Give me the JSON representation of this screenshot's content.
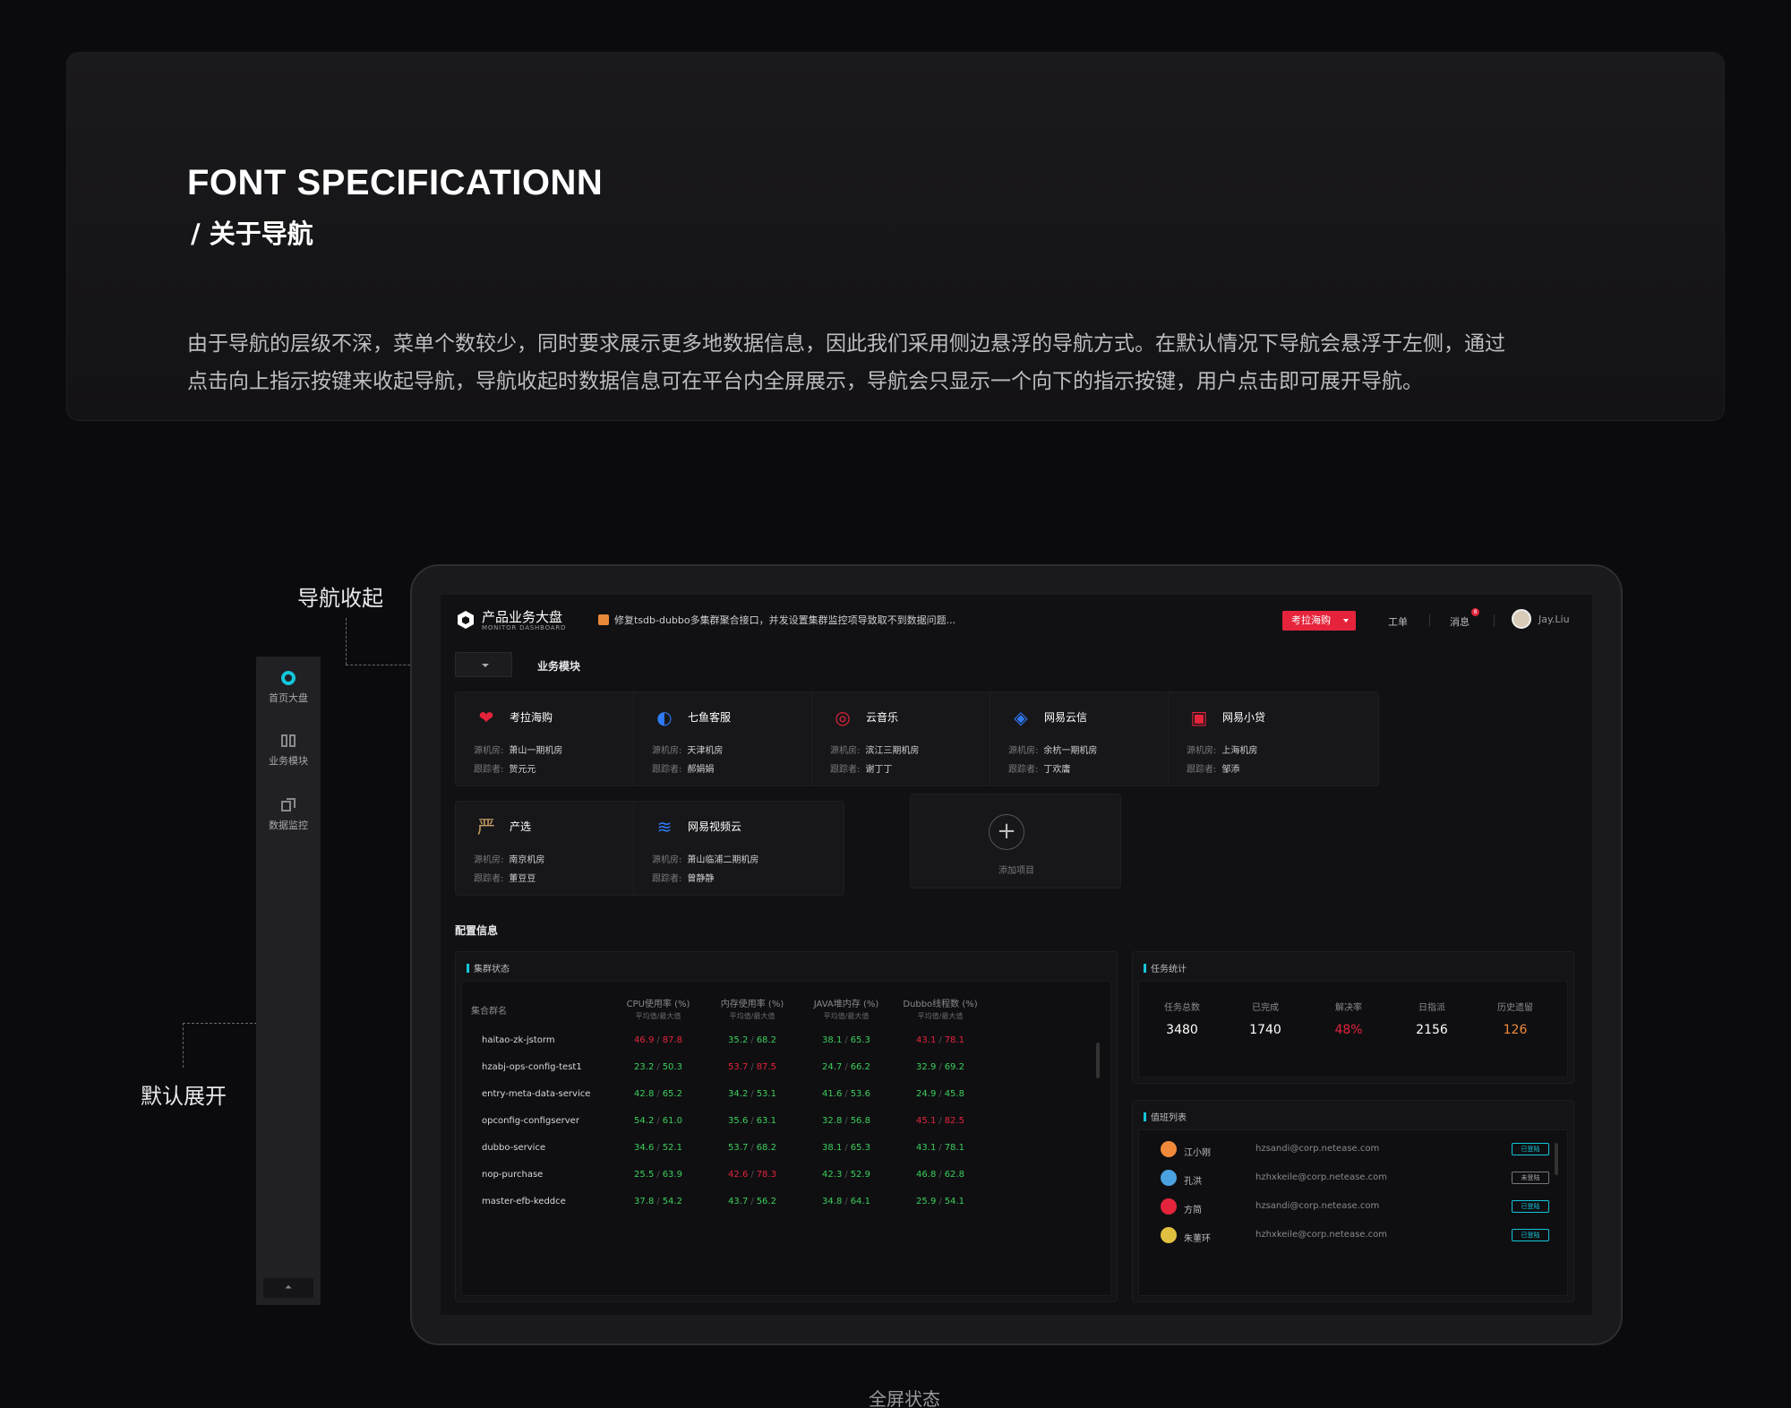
{
  "header": {
    "title": "FONT SPECIFICATIONN",
    "subtitle": "/ 关于导航",
    "desc_line1": "由于导航的层级不深，菜单个数较少，同时要求展示更多地数据信息，因此我们采用侧边悬浮的导航方式。在默认情况下导航会悬浮于左侧，通过",
    "desc_line2": "点击向上指示按键来收起导航，导航收起时数据信息可在平台内全屏展示，导航会只显示一个向下的指示按键，用户点击即可展开导航。"
  },
  "annotations": {
    "collapsed": "导航收起",
    "expanded": "默认展开",
    "caption": "全屏状态"
  },
  "left_nav": {
    "items": [
      {
        "label": "首页大盘",
        "icon": "dashboard-icon"
      },
      {
        "label": "业务模块",
        "icon": "module-icon"
      },
      {
        "label": "数据监控",
        "icon": "monitor-icon"
      }
    ]
  },
  "topbar": {
    "logo_title": "产品业务大盘",
    "logo_sub": "MONITOR DASHBOARD",
    "notice": "修复tsdb-dubbo多集群聚合接口，并发设置集群监控项导致取不到数据问题...",
    "project_button": "考拉海购",
    "links": {
      "work": "工单",
      "msg": "消息"
    },
    "msg_count": "8",
    "user": "Jay.Liu"
  },
  "modules": {
    "section_title": "业务模块",
    "label_room": "源机房:",
    "label_owner": "跟踪者:",
    "cards": [
      {
        "name": "考拉海购",
        "room": "萧山一期机房",
        "owner": "贺元元",
        "icon": "kaola-icon",
        "color": "#e5243b",
        "glyph": "❤"
      },
      {
        "name": "七鱼客服",
        "room": "天津机房",
        "owner": "郝娟娟",
        "icon": "qiyu-icon",
        "color": "#2f7bf5",
        "glyph": "◐"
      },
      {
        "name": "云音乐",
        "room": "滨江三期机房",
        "owner": "谢丁丁",
        "icon": "music-icon",
        "color": "#e5243b",
        "glyph": "◎"
      },
      {
        "name": "网易云信",
        "room": "余杭一期机房",
        "owner": "丁欢庸",
        "icon": "yunxin-icon",
        "color": "#2f7bf5",
        "glyph": "◈"
      },
      {
        "name": "网易小贷",
        "room": "上海机房",
        "owner": "邹添",
        "icon": "loan-icon",
        "color": "#e5243b",
        "glyph": "▣"
      },
      {
        "name": "产选",
        "room": "南京机房",
        "owner": "董豆豆",
        "icon": "yanxuan-icon",
        "color": "#c9a063",
        "glyph": "严"
      },
      {
        "name": "网易视频云",
        "room": "萧山临浦二期机房",
        "owner": "曾静静",
        "icon": "video-cloud-icon",
        "color": "#2f7bf5",
        "glyph": "≋"
      }
    ],
    "add_label": "添加项目"
  },
  "config": {
    "section_title": "配置信息",
    "cluster": {
      "title": "集群状态",
      "headers": [
        {
          "label": "集合群名",
          "sub": ""
        },
        {
          "label": "CPU使用率 (%)",
          "sub": "平均值/最大值"
        },
        {
          "label": "内存使用率 (%)",
          "sub": "平均值/最大值"
        },
        {
          "label": "JAVA堆内存 (%)",
          "sub": "平均值/最大值"
        },
        {
          "label": "Dubbo线程数 (%)",
          "sub": "平均值/最大值"
        }
      ],
      "rows": [
        {
          "name": "haitao-zk-jstorm",
          "cells": [
            [
              "46.9",
              "87.8",
              "r"
            ],
            [
              "35.2",
              "68.2",
              "g"
            ],
            [
              "38.1",
              "65.3",
              "g"
            ],
            [
              "43.1",
              "78.1",
              "r"
            ]
          ]
        },
        {
          "name": "hzabj-ops-config-test1",
          "cells": [
            [
              "23.2",
              "50.3",
              "g"
            ],
            [
              "53.7",
              "87.5",
              "r"
            ],
            [
              "24.7",
              "66.2",
              "g"
            ],
            [
              "32.9",
              "69.2",
              "g"
            ]
          ]
        },
        {
          "name": "entry-meta-data-service",
          "cells": [
            [
              "42.8",
              "65.2",
              "g"
            ],
            [
              "34.2",
              "53.1",
              "g"
            ],
            [
              "41.6",
              "53.6",
              "g"
            ],
            [
              "24.9",
              "45.8",
              "g"
            ]
          ]
        },
        {
          "name": "opconfig-configserver",
          "cells": [
            [
              "54.2",
              "61.0",
              "g"
            ],
            [
              "35.6",
              "63.1",
              "g"
            ],
            [
              "32.8",
              "56.8",
              "g"
            ],
            [
              "45.1",
              "82.5",
              "r"
            ]
          ]
        },
        {
          "name": "dubbo-service",
          "cells": [
            [
              "34.6",
              "52.1",
              "g"
            ],
            [
              "53.7",
              "68.2",
              "g"
            ],
            [
              "38.1",
              "65.3",
              "g"
            ],
            [
              "43.1",
              "78.1",
              "g"
            ]
          ]
        },
        {
          "name": "nop-purchase",
          "cells": [
            [
              "25.5",
              "63.9",
              "g"
            ],
            [
              "42.6",
              "78.3",
              "r"
            ],
            [
              "42.3",
              "52.9",
              "g"
            ],
            [
              "46.8",
              "62.8",
              "g"
            ]
          ]
        },
        {
          "name": "master-efb-keddce",
          "cells": [
            [
              "37.8",
              "54.2",
              "g"
            ],
            [
              "43.7",
              "56.2",
              "g"
            ],
            [
              "34.8",
              "64.1",
              "g"
            ],
            [
              "25.9",
              "54.1",
              "g"
            ]
          ]
        }
      ]
    },
    "tasks": {
      "title": "任务统计",
      "items": [
        {
          "label": "任务总数",
          "value": "3480",
          "color": "#ffffff"
        },
        {
          "label": "已完成",
          "value": "1740",
          "color": "#ffffff"
        },
        {
          "label": "解决率",
          "value": "48%",
          "color": "#e5243b"
        },
        {
          "label": "日指派",
          "value": "2156",
          "color": "#ffffff"
        },
        {
          "label": "历史遗留",
          "value": "126",
          "color": "#f08a3a"
        }
      ]
    },
    "duty": {
      "title": "值班列表",
      "rows": [
        {
          "name": "江小刚",
          "email": "hzsandi@corp.netease.com",
          "status": "已登陆",
          "online": true,
          "color": "#f08a3a"
        },
        {
          "name": "孔洪",
          "email": "hzhxkeile@corp.netease.com",
          "status": "未登陆",
          "online": false,
          "color": "#4aa3e0"
        },
        {
          "name": "方简",
          "email": "hzsandi@corp.netease.com",
          "status": "已登陆",
          "online": true,
          "color": "#e5243b"
        },
        {
          "name": "朱董环",
          "email": "hzhxkeile@corp.netease.com",
          "status": "已登陆",
          "online": true,
          "color": "#e0c040"
        }
      ]
    }
  }
}
